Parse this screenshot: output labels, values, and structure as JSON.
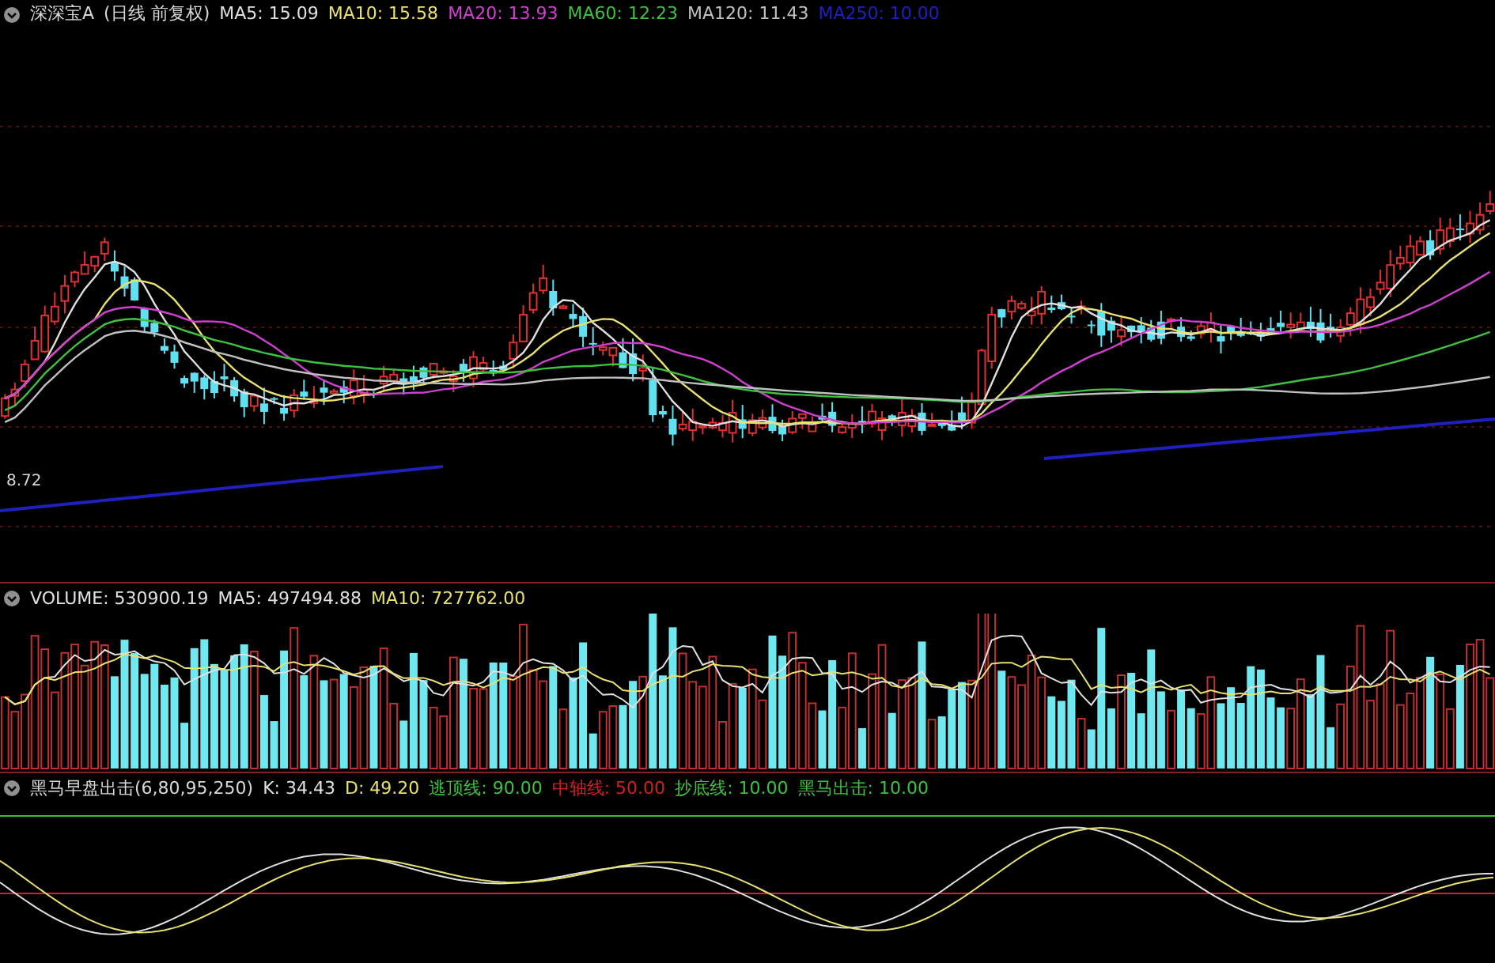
{
  "main_panel": {
    "title": "深深宝A",
    "mode": "(日线 前复权)",
    "indicators": [
      {
        "label": "MA5: 15.09",
        "color": "#e0e0e0"
      },
      {
        "label": "MA10: 15.58",
        "color": "#e8e070"
      },
      {
        "label": "MA20: 13.93",
        "color": "#d040d0"
      },
      {
        "label": "MA60: 12.23",
        "color": "#40c040"
      },
      {
        "label": "MA120: 11.43",
        "color": "#c0c0c0"
      },
      {
        "label": "MA250: 10.00",
        "color": "#2020c0"
      }
    ],
    "low_marker": "8.72"
  },
  "volume_panel": {
    "indicators": [
      {
        "label": "VOLUME: 530900.19",
        "color": "#e0e0e0"
      },
      {
        "label": "MA5: 497494.88",
        "color": "#e0e0e0"
      },
      {
        "label": "MA10: 727762.00",
        "color": "#e8e070"
      }
    ]
  },
  "indicator_panel": {
    "title": "黑马早盘出击(6,80,95,250)",
    "indicators": [
      {
        "label": "K: 34.43",
        "color": "#e0e0e0"
      },
      {
        "label": "D: 49.20",
        "color": "#e8e070"
      },
      {
        "label": "逃顶线: 90.00",
        "color": "#40c040"
      },
      {
        "label": "中轴线: 50.00",
        "color": "#d02020"
      },
      {
        "label": "抄底线: 10.00",
        "color": "#40c040"
      },
      {
        "label": "黑马出击: 10.00",
        "color": "#40c040"
      }
    ]
  }
}
